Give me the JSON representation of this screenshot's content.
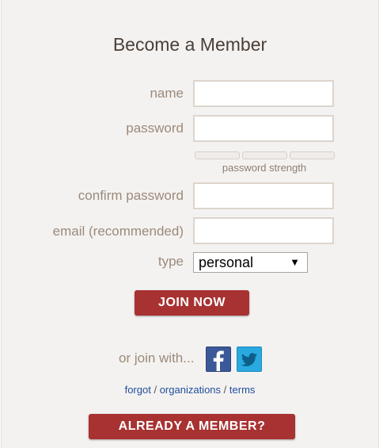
{
  "form": {
    "title": "Become a Member",
    "name_label": "name",
    "password_label": "password",
    "password_strength_caption": "password strength",
    "confirm_label": "confirm password",
    "email_label": "email (recommended)",
    "type_label": "type",
    "type_selected": "personal",
    "join_button": "JOIN NOW"
  },
  "social": {
    "prompt": "or join with...",
    "icons": [
      "facebook-icon",
      "twitter-icon"
    ]
  },
  "links": {
    "forgot": "forgot",
    "organizations": "organizations",
    "terms": "terms",
    "separator": "/"
  },
  "member_button": "ALREADY A MEMBER?",
  "colors": {
    "panel_bg": "#f4f2f1",
    "button_red": "#a83232",
    "label_tan": "#9b8a79",
    "link_blue": "#1f4e9b",
    "facebook_blue": "#3b5998",
    "twitter_blue": "#2aa9e0"
  }
}
